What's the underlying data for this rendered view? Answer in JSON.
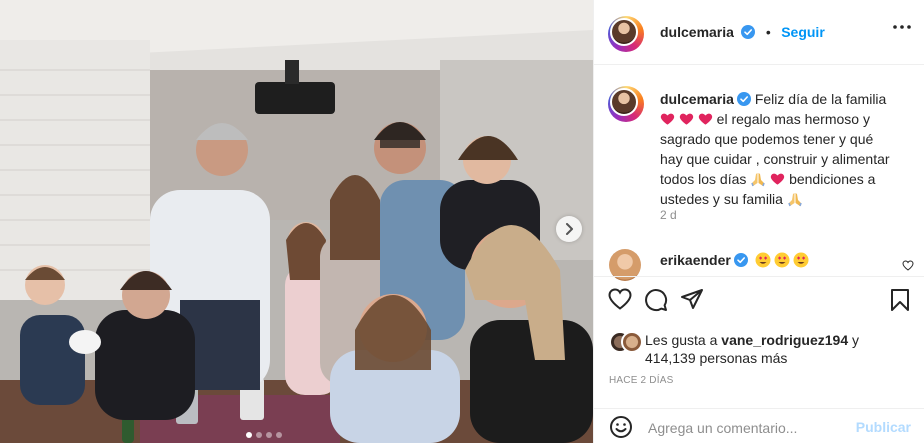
{
  "photo": {
    "alt_subject": "family-group-selfie",
    "carousel_dots": 4,
    "active_dot": 0
  },
  "header": {
    "username": "dulcemaria",
    "separator": "•",
    "follow_label": "Seguir"
  },
  "caption": {
    "username": "dulcemaria",
    "text_1": "Feliz día de la familia",
    "text_2": "el regalo mas hermoso y sagrado que podemos tener y qué hay que cuidar , construir y alimentar todos los días",
    "text_3": "bendiciones a ustedes y su familia",
    "time_ago": "2 d"
  },
  "comment": {
    "username": "erikaender"
  },
  "likes": {
    "prefix": "Les gusta a",
    "liker": "vane_rodriguez194",
    "conj": "y",
    "count_text": "414,139 personas más"
  },
  "post_date": "HACE 2 DÍAS",
  "comment_box": {
    "placeholder": "Agrega un comentario...",
    "publish_label": "Publicar"
  },
  "colors": {
    "link_blue": "#0095f6",
    "verified_blue": "#3897f0",
    "publish_disabled": "#b3dbff",
    "heart_red": "#e0245e"
  }
}
